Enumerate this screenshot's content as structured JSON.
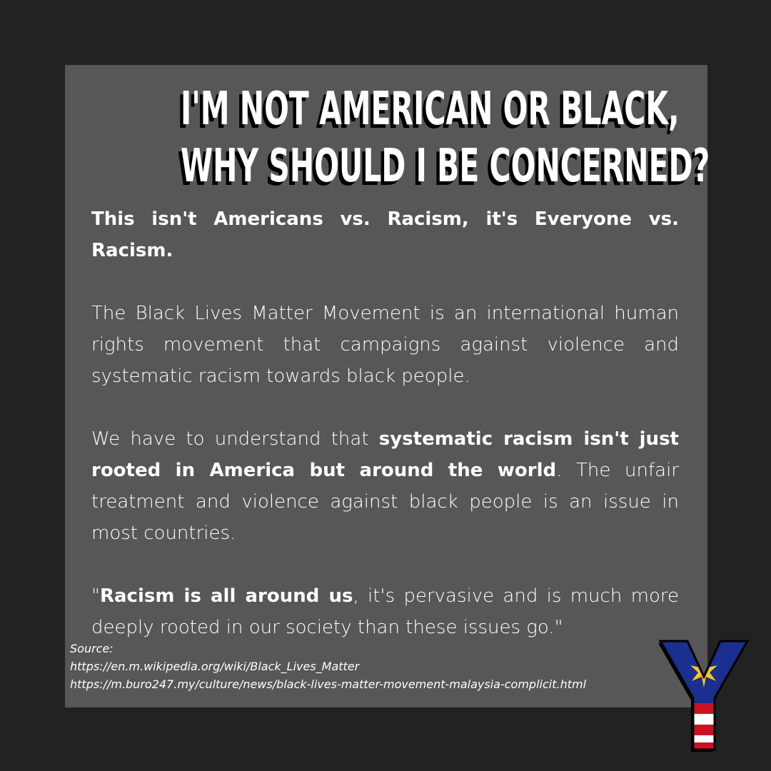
{
  "headline": {
    "line1": "I'M NOT AMERICAN OR BLACK,",
    "line2": "WHY SHOULD I BE CONCERNED?"
  },
  "lead": "This isn't Americans vs. Racism, it's Everyone vs. Racism.",
  "para1": "The Black Lives Matter Movement is an international human rights movement that campaigns against violence and systematic racism towards black people.",
  "para2": {
    "start": "We have to understand that ",
    "bold": "systematic racism isn't just rooted in America but around the world",
    "end": ". The unfair treatment and violence against black people is an issue in most countries."
  },
  "quote": {
    "open": "\"",
    "bold": "Racism is all around us",
    "end": ", it's pervasive and is much more deeply rooted in our society than these issues go.\""
  },
  "source": {
    "label": "Source:",
    "link1": "https://en.m.wikipedia.org/wiki/Black_Lives_Matter",
    "link2": "https://m.buro247.my/culture/news/black-lives-matter-movement-malaysia-complicit.html"
  },
  "logo": {
    "letter": "Y",
    "icon": "malaysia-flag-y-logo"
  },
  "colors": {
    "background": "#222222",
    "card": "#575757",
    "text": "#ffffff",
    "flag_blue": "#1a2f8f",
    "flag_yellow": "#f7c818",
    "flag_red": "#cc1122"
  }
}
